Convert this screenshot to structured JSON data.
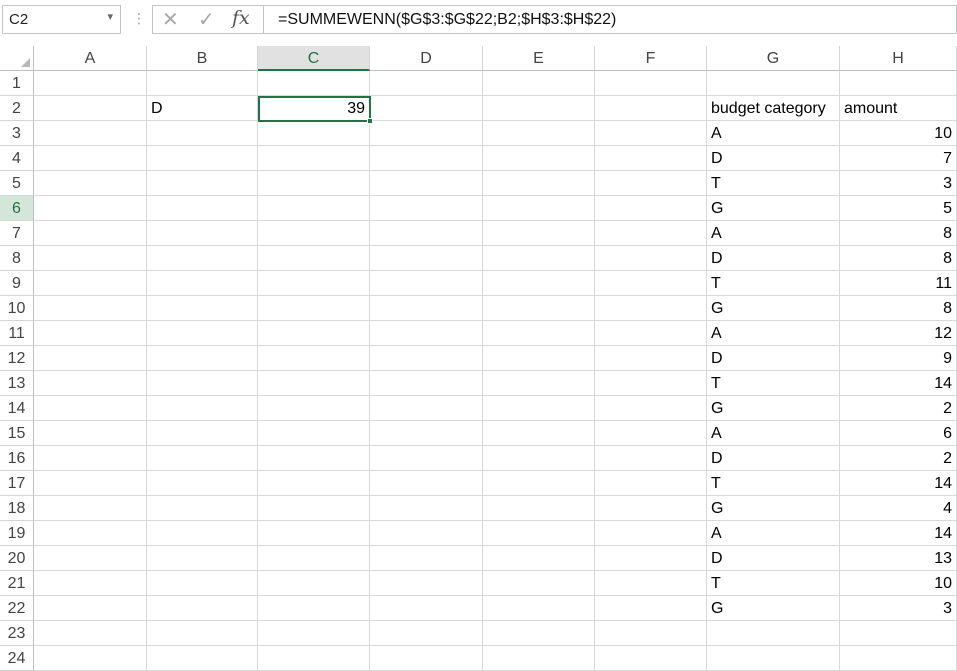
{
  "name_box": {
    "value": "C2",
    "arrow": "▾"
  },
  "formula_bar": {
    "dots": "⋮",
    "cancel_symbol": "✕",
    "enter_symbol": "✓",
    "fx_symbol": "fx",
    "formula": "=SUMMEWENN($G$3:$G$22;B2;$H$3:$H$22)"
  },
  "columns": [
    "A",
    "B",
    "C",
    "D",
    "E",
    "F",
    "G",
    "H"
  ],
  "selected_column": "C",
  "rows": [
    "1",
    "2",
    "3",
    "4",
    "5",
    "6",
    "7",
    "8",
    "9",
    "10",
    "11",
    "12",
    "13",
    "14",
    "15",
    "16",
    "17",
    "18",
    "19",
    "20",
    "21",
    "22",
    "23",
    "24"
  ],
  "highlighted_row": "6",
  "cells": {
    "B2": "D",
    "C2": "39",
    "G2": "budget category",
    "H2": "amount"
  },
  "table": [
    {
      "category": "A",
      "amount": "10"
    },
    {
      "category": "D",
      "amount": "7"
    },
    {
      "category": "T",
      "amount": "3"
    },
    {
      "category": "G",
      "amount": "5"
    },
    {
      "category": "A",
      "amount": "8"
    },
    {
      "category": "D",
      "amount": "8"
    },
    {
      "category": "T",
      "amount": "11"
    },
    {
      "category": "G",
      "amount": "8"
    },
    {
      "category": "A",
      "amount": "12"
    },
    {
      "category": "D",
      "amount": "9"
    },
    {
      "category": "T",
      "amount": "14"
    },
    {
      "category": "G",
      "amount": "2"
    },
    {
      "category": "A",
      "amount": "6"
    },
    {
      "category": "D",
      "amount": "2"
    },
    {
      "category": "T",
      "amount": "14"
    },
    {
      "category": "G",
      "amount": "4"
    },
    {
      "category": "A",
      "amount": "14"
    },
    {
      "category": "D",
      "amount": "13"
    },
    {
      "category": "T",
      "amount": "10"
    },
    {
      "category": "G",
      "amount": "3"
    }
  ],
  "colors": {
    "accent": "#217346",
    "selected_row_header": "#d3e6d9"
  }
}
